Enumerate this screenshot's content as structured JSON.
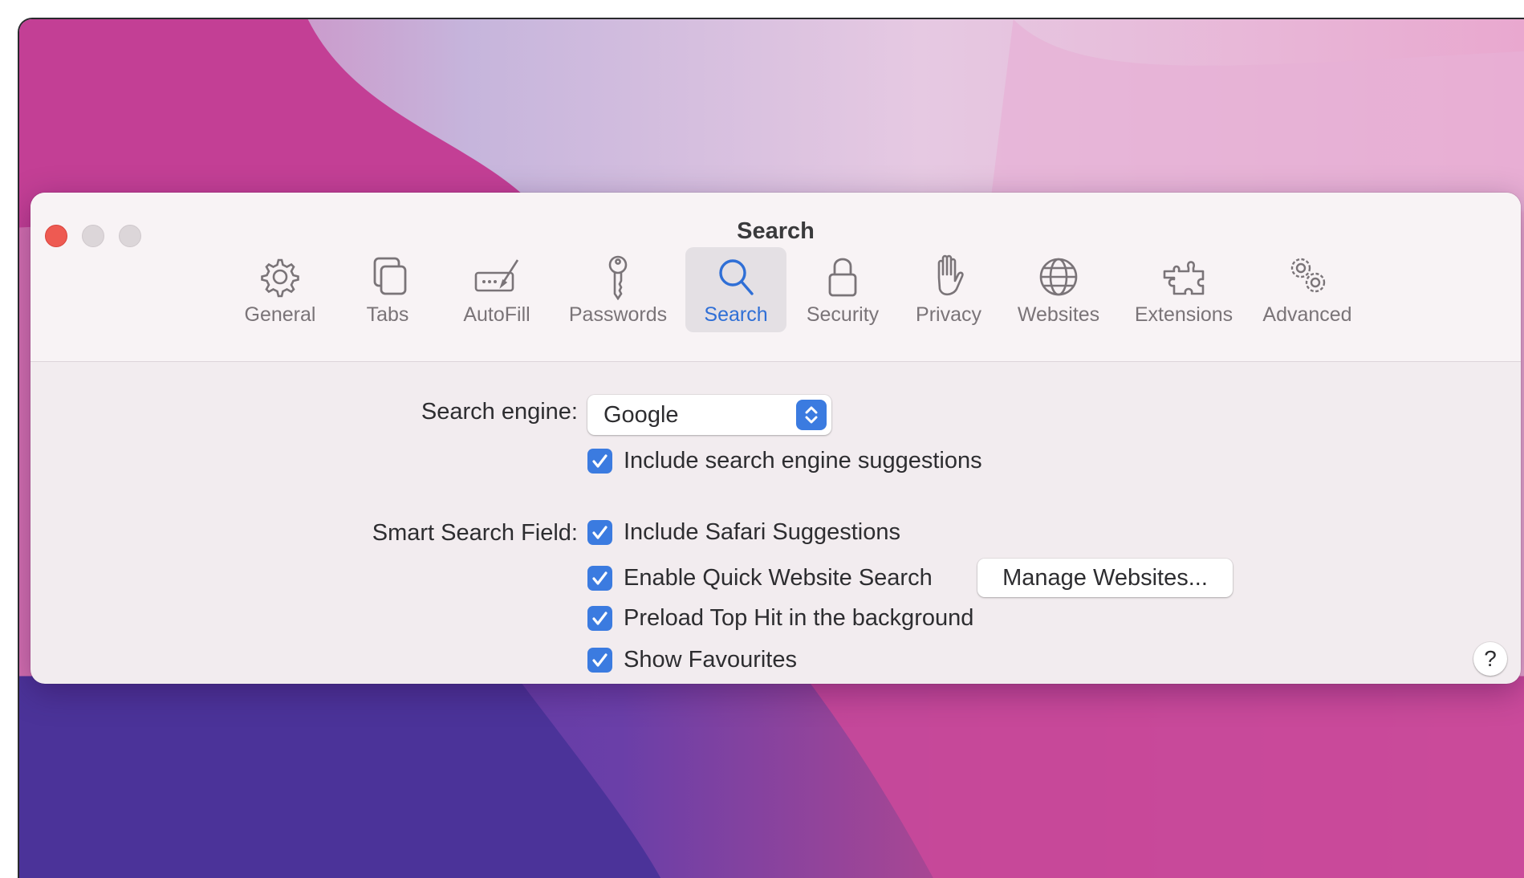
{
  "window": {
    "title": "Search"
  },
  "toolbar": {
    "items": [
      {
        "label": "General",
        "icon": "gear-icon",
        "selected": false
      },
      {
        "label": "Tabs",
        "icon": "tabs-icon",
        "selected": false
      },
      {
        "label": "AutoFill",
        "icon": "autofill-icon",
        "selected": false
      },
      {
        "label": "Passwords",
        "icon": "key-icon",
        "selected": false
      },
      {
        "label": "Search",
        "icon": "magnifier-icon",
        "selected": true
      },
      {
        "label": "Security",
        "icon": "lock-icon",
        "selected": false
      },
      {
        "label": "Privacy",
        "icon": "hand-icon",
        "selected": false
      },
      {
        "label": "Websites",
        "icon": "globe-icon",
        "selected": false
      },
      {
        "label": "Extensions",
        "icon": "puzzle-icon",
        "selected": false
      },
      {
        "label": "Advanced",
        "icon": "gears-icon",
        "selected": false
      }
    ]
  },
  "search": {
    "engine_label": "Search engine:",
    "engine_value": "Google",
    "include_engine_suggestions": {
      "label": "Include search engine suggestions",
      "checked": true
    }
  },
  "smart_field": {
    "label": "Smart Search Field:",
    "options": [
      {
        "label": "Include Safari Suggestions",
        "checked": true
      },
      {
        "label": "Enable Quick Website Search",
        "checked": true
      },
      {
        "label": "Preload Top Hit in the background",
        "checked": true
      },
      {
        "label": "Show Favourites",
        "checked": true
      }
    ],
    "manage_button": "Manage Websites..."
  },
  "help": {
    "label": "?"
  },
  "colors": {
    "accent": "#3b7be0",
    "close": "#ee5a52",
    "window_bg": "#f2ecef"
  }
}
